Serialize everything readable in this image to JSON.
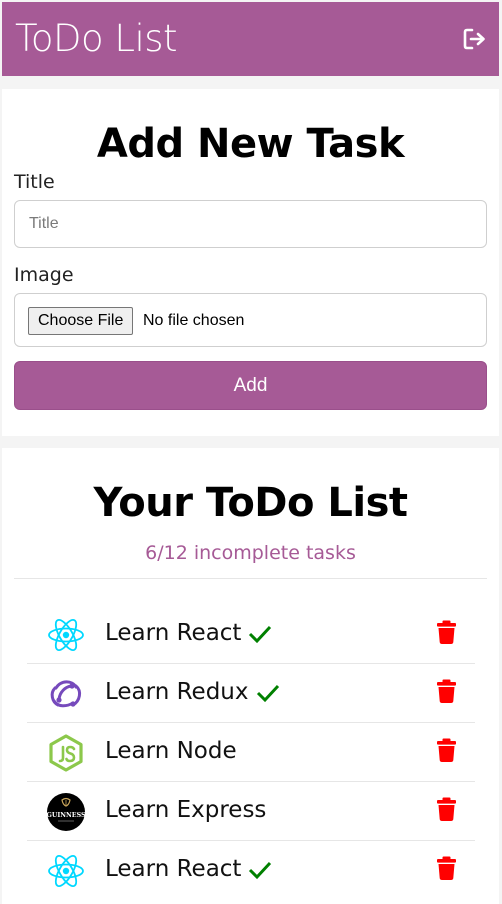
{
  "navbar": {
    "title": "ToDo List",
    "logout_icon": "logout-icon"
  },
  "form": {
    "heading": "Add New Task",
    "title_label": "Title",
    "title_placeholder": "Title",
    "title_value": "",
    "image_label": "Image",
    "file_button": "Choose File",
    "file_status": "No file chosen",
    "add_button": "Add"
  },
  "list": {
    "heading": "Your ToDo List",
    "summary": "6/12 incomplete tasks",
    "tasks": [
      {
        "label": "Learn React",
        "icon": "react-logo-icon",
        "completed": true
      },
      {
        "label": "Learn Redux",
        "icon": "redux-logo-icon",
        "completed": true
      },
      {
        "label": "Learn Node",
        "icon": "nodejs-logo-icon",
        "completed": false
      },
      {
        "label": "Learn Express",
        "icon": "guinness-logo-icon",
        "completed": false
      },
      {
        "label": "Learn React",
        "icon": "react-logo-icon",
        "completed": true
      }
    ]
  },
  "colors": {
    "brand": "#a65a96",
    "check": "#008000",
    "delete": "#ff0000",
    "react": "#00d8ff",
    "redux": "#764abc",
    "node": "#8cc84b"
  }
}
